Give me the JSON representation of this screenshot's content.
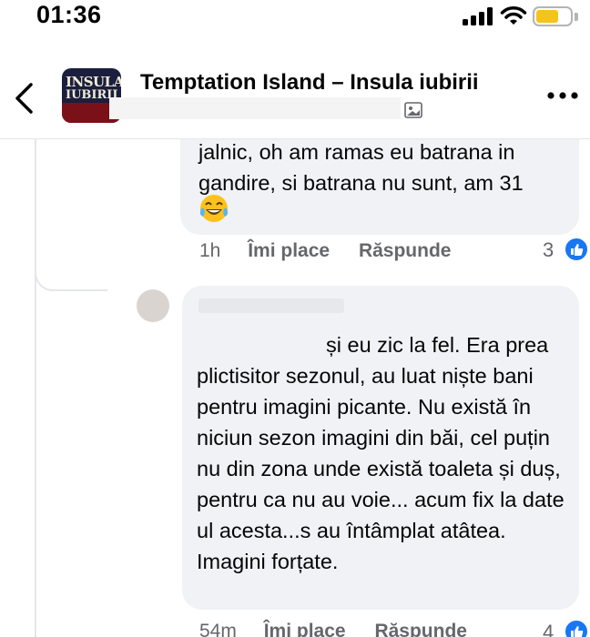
{
  "status_bar": {
    "time": "01:36"
  },
  "header": {
    "group_title": "Temptation Island – Insula iubirii",
    "avatar_line1": "INSULA",
    "avatar_line2": "IUBIRII"
  },
  "comments": [
    {
      "text_line1": "jalnic, oh am ramas eu batrana in",
      "text_line2": "gandire, si batrana nu sunt, am 31",
      "emoji": "laughing-with-tears",
      "time": "1h",
      "like_label": "Îmi place",
      "reply_label": "Răspunde",
      "reaction_count": "3"
    },
    {
      "text": "și eu zic la fel. Era prea plictisitor sezonul, au luat niște bani pentru imagini picante. Nu există în niciun sezon imagini din băi, cel puțin nu din zona unde există toaleta și duș, pentru ca nu au voie... acum fix la date ul acesta...s au întâmplat atâtea. Imagini forțate.",
      "time": "54m",
      "like_label": "Îmi place",
      "reply_label": "Răspunde",
      "reaction_count": "4"
    }
  ],
  "colors": {
    "bubble": "#f0f2f5",
    "secondary_text": "#65676b",
    "like_blue": "#1877f2"
  }
}
